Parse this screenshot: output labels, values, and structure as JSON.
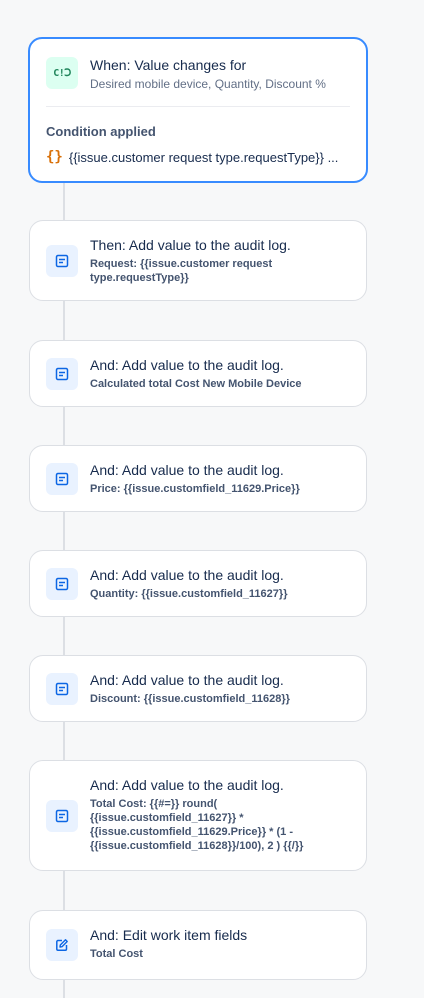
{
  "trigger": {
    "icon": "value-change-icon",
    "title": "When: Value changes for",
    "fields": "Desired mobile device, Quantity, Discount %",
    "condition_label": "Condition applied",
    "condition_icon": "braces-icon",
    "condition_text": "{{issue.customer request type.requestType}} ..."
  },
  "actions": [
    {
      "icon": "audit-log-icon",
      "title": "Then: Add value to the audit log.",
      "detail": "Request: {{issue.customer request type.requestType}}"
    },
    {
      "icon": "audit-log-icon",
      "title": "And: Add value to the audit log.",
      "detail": "Calculated total Cost New Mobile Device"
    },
    {
      "icon": "audit-log-icon",
      "title": "And: Add value to the audit log.",
      "detail": "Price: {{issue.customfield_11629.Price}}"
    },
    {
      "icon": "audit-log-icon",
      "title": "And: Add value to the audit log.",
      "detail": "Quantity: {{issue.customfield_11627}}"
    },
    {
      "icon": "audit-log-icon",
      "title": "And: Add value to the audit log.",
      "detail": "Discount: {{issue.customfield_11628}}"
    },
    {
      "icon": "audit-log-icon",
      "title": "And: Add value to the audit log.",
      "detail": "Total Cost: {{#=}} round( {{issue.customfield_11627}} * {{issue.customfield_11629.Price}} * (1 - {{issue.customfield_11628}}/100), 2 ) {{/}}"
    },
    {
      "icon": "edit-icon",
      "title": "And: Edit work item fields",
      "detail": "Total Cost"
    }
  ],
  "colors": {
    "trigger_border": "#388bff",
    "trigger_icon_bg": "#dcfff1",
    "action_icon_bg": "#e9f2ff",
    "action_icon_fg": "#0c66e4",
    "brace": "#d97008"
  }
}
